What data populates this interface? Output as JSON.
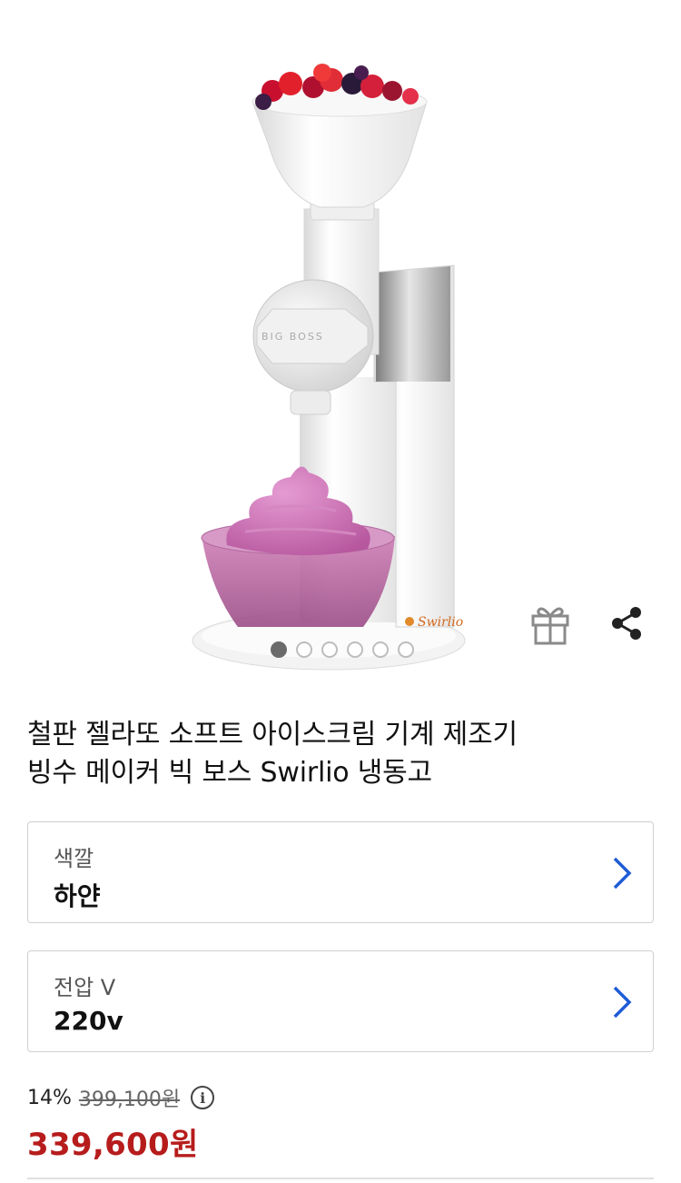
{
  "gallery": {
    "image_alt": "Swirlio 젤라또 아이스크림 메이커",
    "brand_mark": "BIG BOSS",
    "logo_text": "Swirlio",
    "slide_count": 6,
    "active_slide": 1,
    "gift_icon": "gift-icon",
    "share_icon": "share-icon"
  },
  "product": {
    "title_line1": "철판 젤라또 소프트 아이스크림 기계 제조기",
    "title_line2": "빙수 메이커 빅 보스 Swirlio 냉동고"
  },
  "options": {
    "color": {
      "label": "색깔",
      "value": "하얀"
    },
    "voltage": {
      "label": "전압 V",
      "value": "220v"
    }
  },
  "price": {
    "discount": "14%",
    "original": "399,100원",
    "sale": "339,600원",
    "info_icon": "info-icon"
  },
  "colors": {
    "sale_price": "#b71c1c",
    "chevron": "#1e5bd6"
  }
}
